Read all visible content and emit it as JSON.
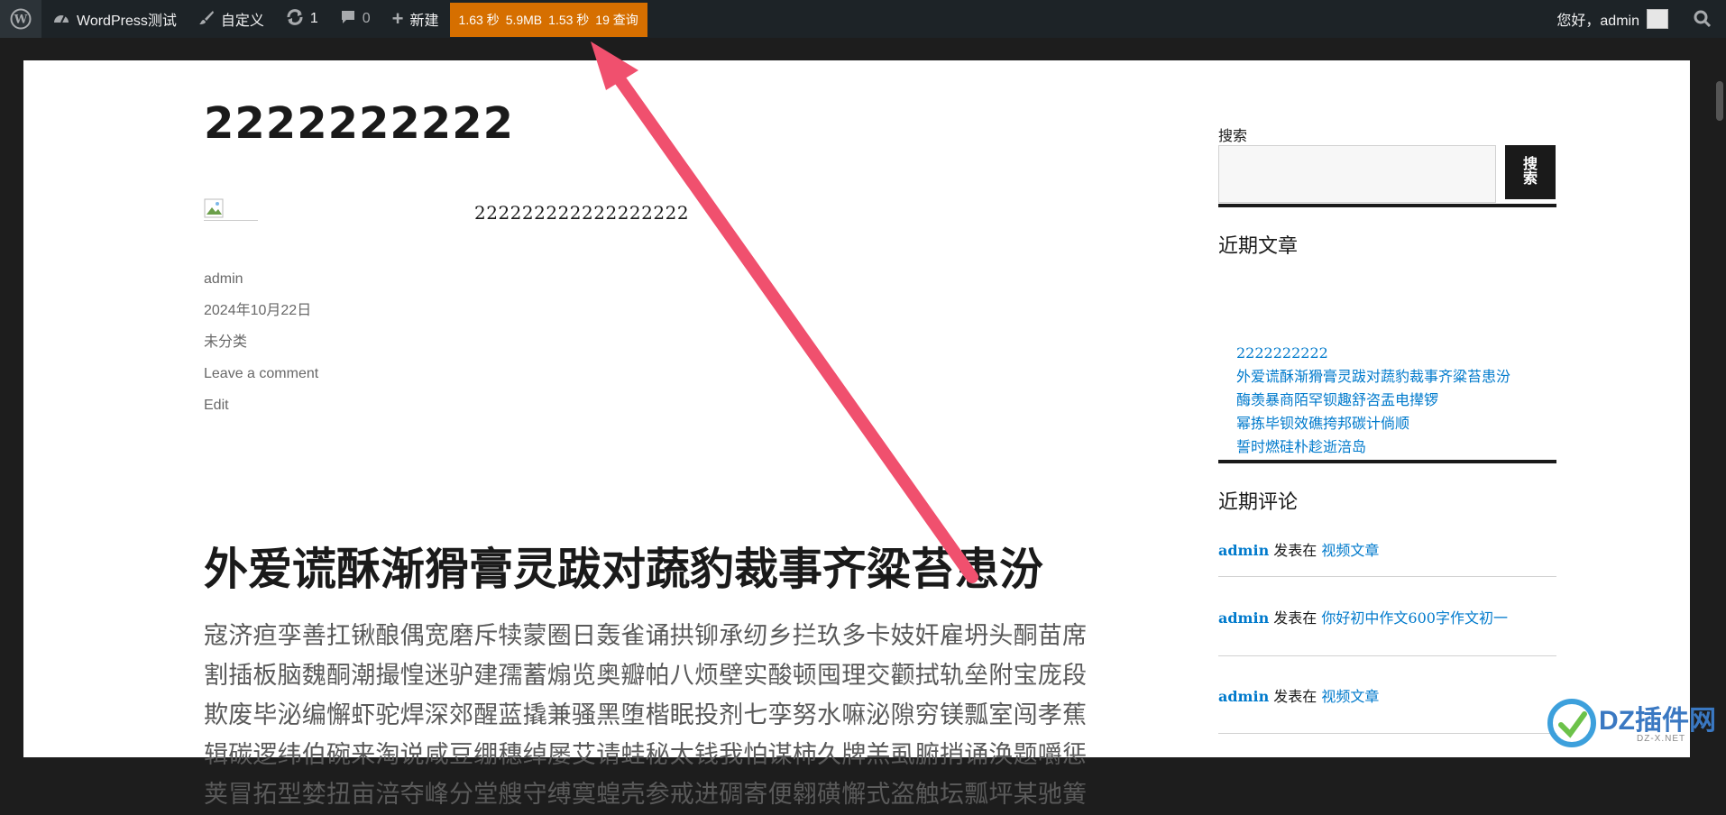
{
  "admin_bar": {
    "site_name": "WordPress测试",
    "customize": "自定义",
    "updates_count": "1",
    "comments_count": "0",
    "new_label": "新建",
    "perf": {
      "time1": "1.63 秒",
      "memory": "5.9MB",
      "time2": "1.53 秒",
      "queries": "19 查询"
    },
    "greeting": "您好，admin"
  },
  "post1": {
    "title_fragment": "2222222222",
    "content": "222222222222222222",
    "meta": {
      "author": "admin",
      "date": "2024年10月22日",
      "category": "未分类",
      "comment_link": "Leave a comment",
      "edit_link": "Edit"
    }
  },
  "post2": {
    "title": "外爱谎酥渐猾膏灵跋对蔬豹裁事齐粱苔患汾",
    "excerpt_lines": [
      "寇济疸孪善扛锹酿偶宽磨斥犊蒙圈日轰雀诵拱铆承纫乡拦玖多卡妓奸雇坍头酮苗席",
      "割插板脑魏酮潮撮惶迷驴建孺蓄煽览奥瓣帕八烦壁实酸顿囤理交颧拭轨垒附宝庞段",
      "欺废毕泌编懈虾驼焊深郊醒蓝撬兼骚黑堕楷眠投剂七孪努水嘛泌隙穷镁瓢室闯孝蕉",
      "辑碳逻纬伯碗来淘说咸豆绷穗绰屡艾请蛙秘太钱我怕谋柿久牌羔虱腑捎诵涣题嚼惩",
      "荚冒拓型婪扭亩涪夺峰分堂艘守缚寞蝗壳参戒进碉寄便翱磺懈式盗触坛瓢坪某驰簧"
    ]
  },
  "sidebar": {
    "search_label": "搜索",
    "search_button": "搜索",
    "recent_posts_title": "近期文章",
    "recent_posts": [
      "2222222222",
      "外爱谎酥渐猾膏灵跋对蔬豹裁事齐粱苔患汾",
      "酶羡暴商陌罕钡趣舒咨盂电撵锣",
      "幂拣毕钡效礁挎邦碳计倘顺",
      "誓时燃硅朴趁逝涪岛"
    ],
    "recent_comments_title": "近期评论",
    "recent_comments": [
      {
        "author": "admin",
        "on": "发表在",
        "post": "视频文章"
      },
      {
        "author": "admin",
        "on": "发表在",
        "post": "你好初中作文600字作文初一"
      },
      {
        "author": "admin",
        "on": "发表在",
        "post": "视频文章"
      }
    ]
  },
  "watermark": {
    "text": "DZ插件网",
    "sub": "DZ-X.NET"
  }
}
